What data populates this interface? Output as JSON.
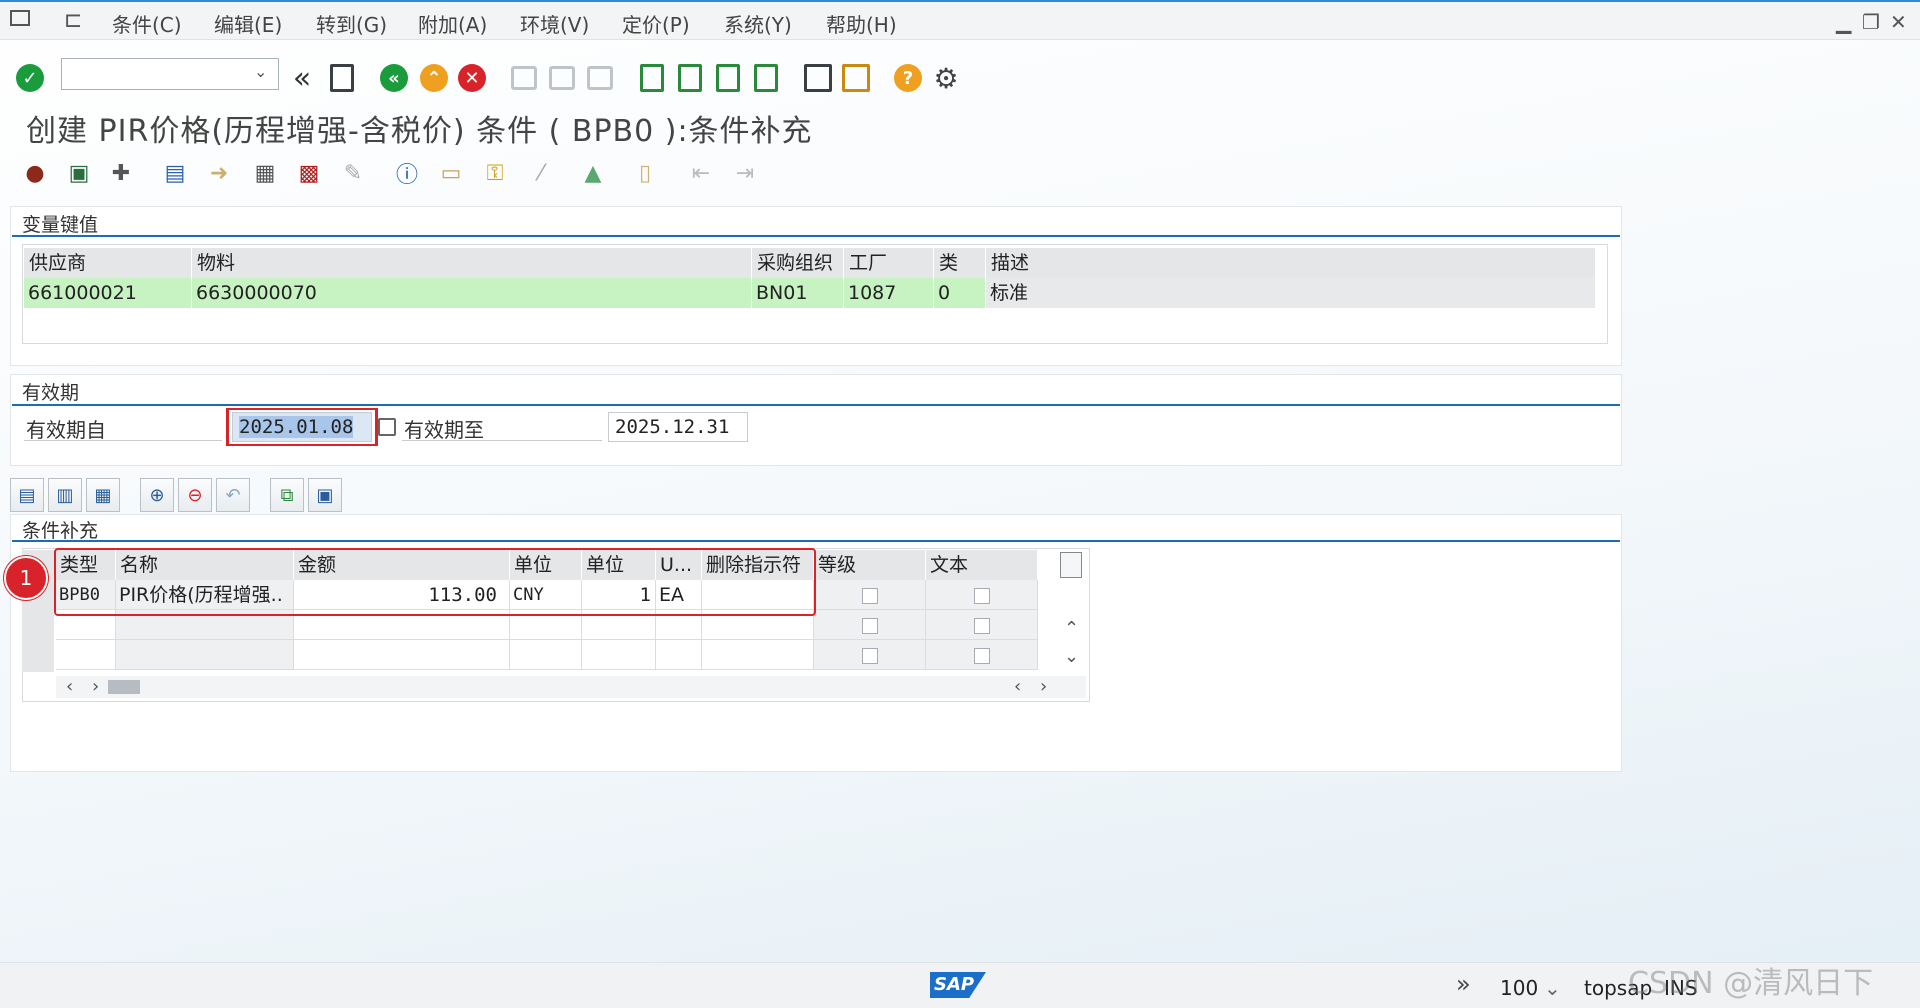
{
  "menu": {
    "items": [
      "条件(C)",
      "编辑(E)",
      "转到(G)",
      "附加(A)",
      "环境(V)",
      "定价(P)",
      "系统(Y)",
      "帮助(H)"
    ]
  },
  "toolbar": {
    "command_field_value": "",
    "icons": [
      "enter-icon",
      "back-double-icon",
      "save-icon",
      "back-icon",
      "exit-icon",
      "cancel-icon",
      "print-icon",
      "find-icon",
      "find-next-icon",
      "first-page-icon",
      "prev-page-icon",
      "next-page-icon",
      "last-page-icon",
      "new-session-icon",
      "shortcut-icon",
      "help-icon",
      "settings-icon"
    ],
    "help_glyph": "?"
  },
  "page": {
    "title": "创建 PIR价格(历程增强-含税价) 条件 ( BPB0 ):条件补充"
  },
  "key_section": {
    "title": "变量键值",
    "columns": [
      "供应商",
      "物料",
      "采购组织",
      "工厂",
      "类",
      "描述"
    ],
    "row": [
      "661000021",
      "6630000070",
      "BN01",
      "1087",
      "0",
      "标准"
    ]
  },
  "validity_section": {
    "title": "有效期",
    "valid_from_label": "有效期自",
    "valid_from_value": "2025.01.08",
    "valid_to_label": "有效期至",
    "valid_to_value": "2025.12.31"
  },
  "condition_section": {
    "title": "条件补充",
    "columns": [
      "类型",
      "名称",
      "金额",
      "单位",
      "单位",
      "U...",
      "删除指示符",
      "等级",
      "文本"
    ],
    "rows": [
      [
        "BPB0",
        "PIR价格(历程增强..",
        "113.00",
        "CNY",
        "1",
        "EA",
        "",
        "",
        ""
      ]
    ],
    "annotation_badge": "1"
  },
  "status_bar": {
    "logo": "SAP",
    "zoom": "100",
    "system": "topsap",
    "mode": "INS",
    "watermark": "CSDN @清风日下"
  },
  "colors": {
    "accent_blue": "#1d6db5",
    "key_row_green": "#c6f3c1",
    "highlight_red": "#d9232a",
    "enter_green": "#1a9c3c",
    "exit_orange": "#f0a020",
    "cancel_red": "#d9232a"
  }
}
